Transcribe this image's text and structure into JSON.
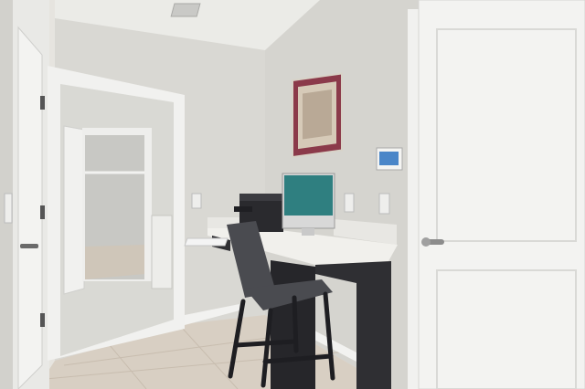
{
  "scene": {
    "description_items": [
      "left-door",
      "hallway-opening",
      "laundry-closet",
      "washer-dryer",
      "right-door",
      "desk",
      "monitor",
      "printer",
      "bar-stool",
      "framed-art",
      "thermostat",
      "tile-floor"
    ]
  },
  "colors": {
    "ceiling": "#ebebe7",
    "wall": "#dcdbd6",
    "wall_right": "#d6d5d0",
    "door": "#f3f3f1",
    "trim": "#f1f1ef",
    "floor": "#d8cfc3",
    "desk_top": "#f1f0ec",
    "desk_base": "#2f2f33",
    "monitor_screen": "#2f7f80",
    "stool_seat": "#4a4b50",
    "stool_leg": "#1e1e22",
    "art_frame": "#8b3a4a",
    "art_mat": "#d6cab8",
    "thermostat_screen": "#4a86c8"
  }
}
